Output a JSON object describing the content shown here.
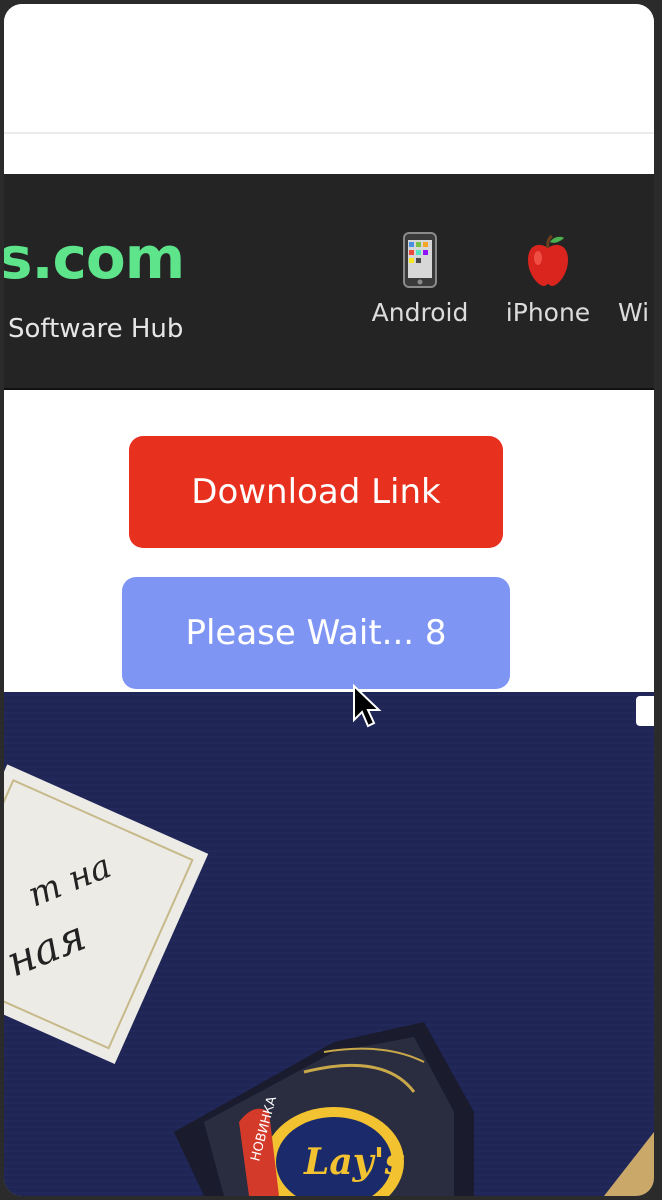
{
  "header": {
    "logo_text": "s.com",
    "tagline": "Software Hub",
    "nav": [
      {
        "label": "Android",
        "icon": "mobile-phone-icon"
      },
      {
        "label": "iPhone",
        "icon": "apple-icon"
      },
      {
        "label": "Wi",
        "icon": ""
      }
    ]
  },
  "buttons": {
    "download_label": "Download Link",
    "wait_label": "Please Wait... 8"
  },
  "ad": {
    "card_line1": "т на",
    "card_line2": "ная",
    "badge_text": "НОВИНКА",
    "brand_text": "Lay's"
  },
  "colors": {
    "logo_green": "#5ee48a",
    "download_red": "#e8301f",
    "wait_blue": "#7f95f4",
    "header_dark": "#242424",
    "ad_navy": "#1f2555"
  }
}
